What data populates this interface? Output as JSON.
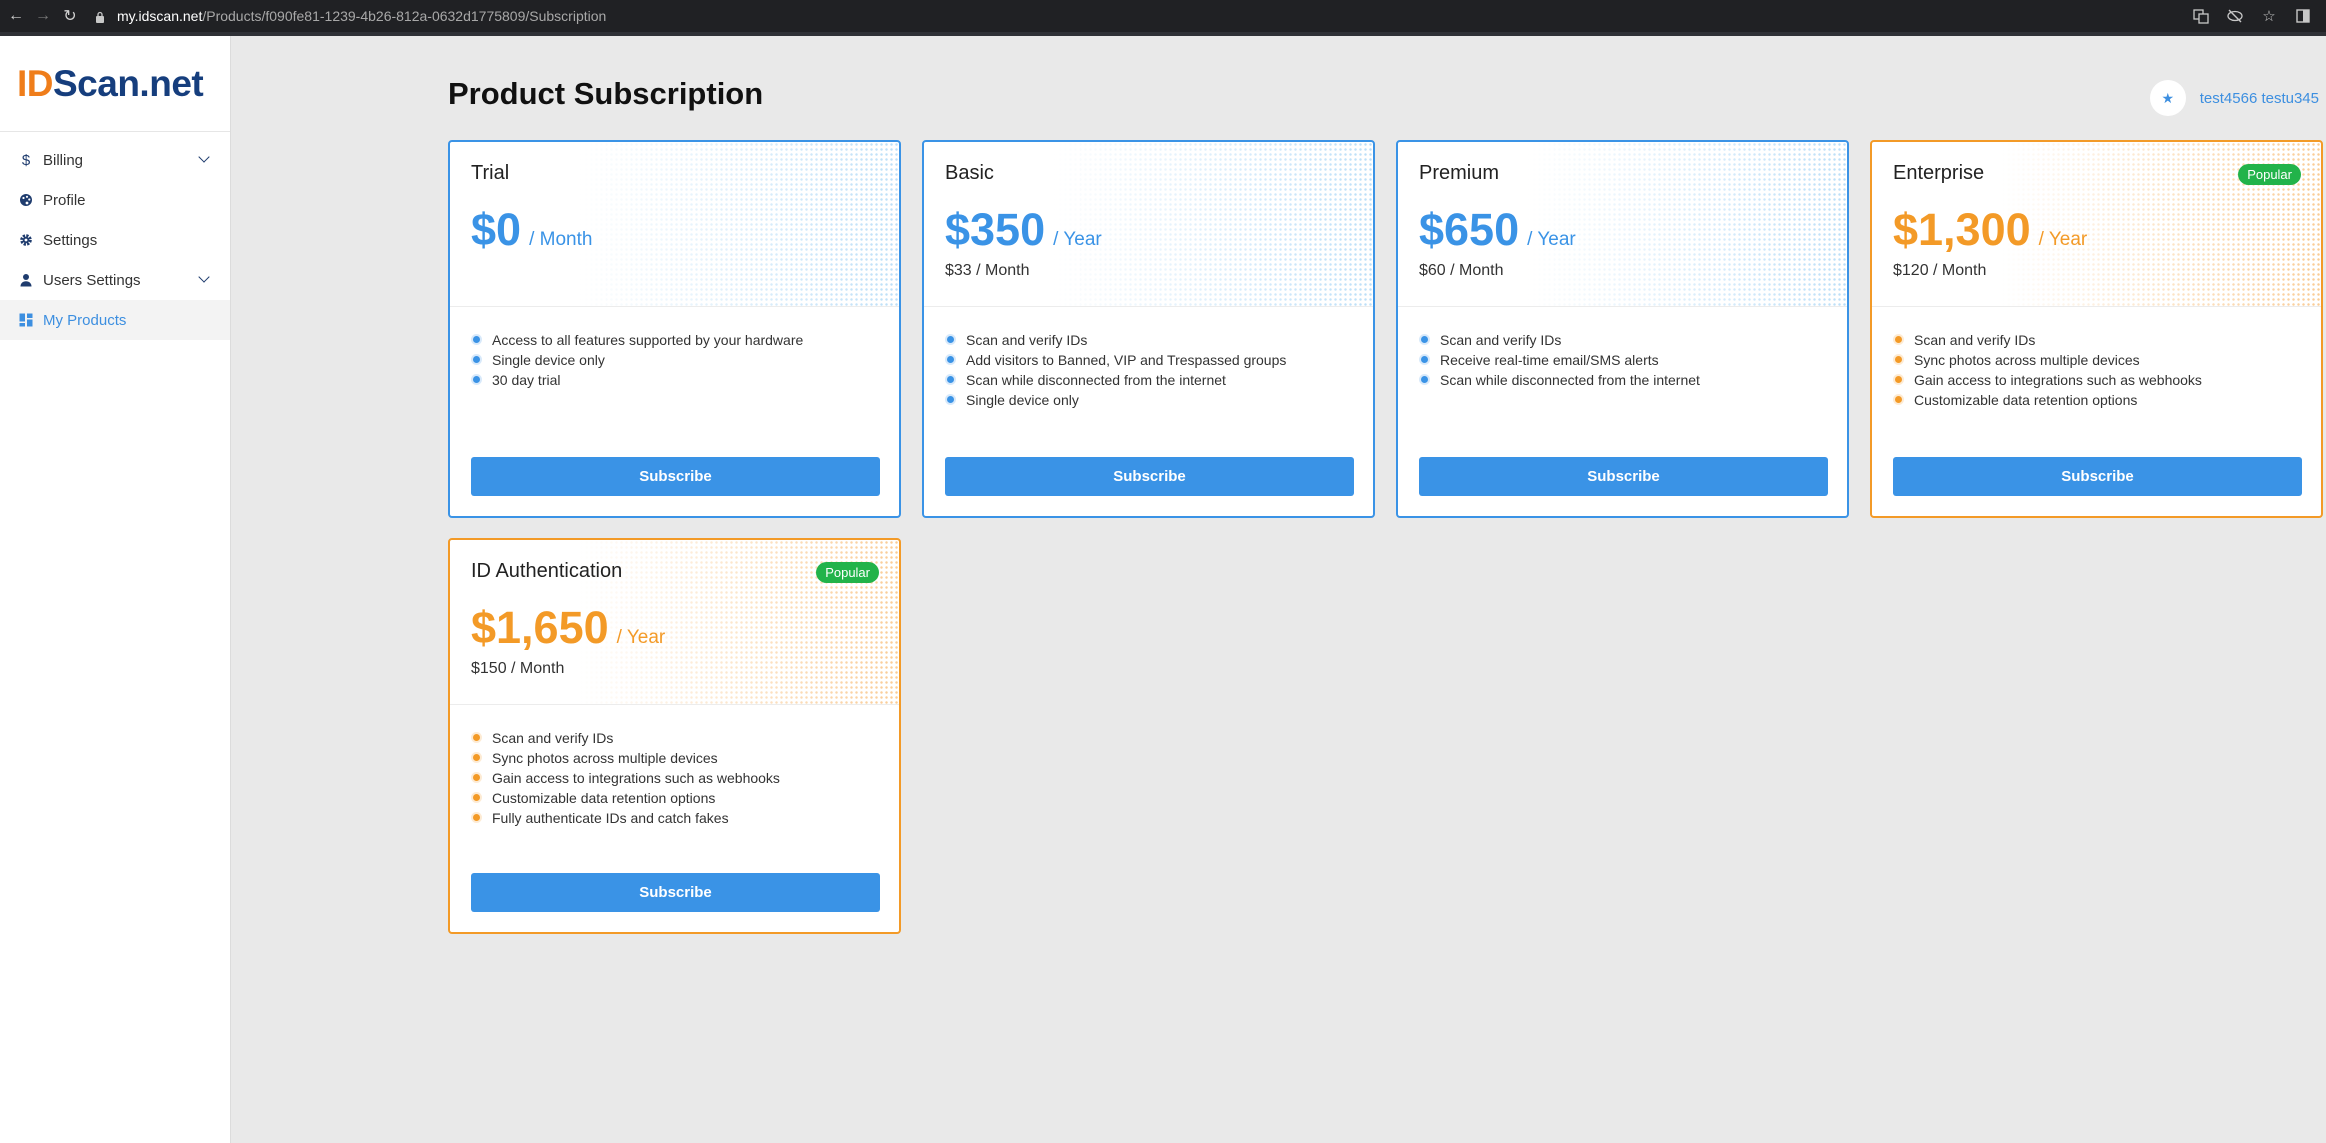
{
  "browser": {
    "url_host": "my.idscan.net",
    "url_path": "/Products/f090fe81-1239-4b26-812a-0632d1775809/Subscription"
  },
  "logo": {
    "id_text": "ID",
    "rest_text": "Scan.net"
  },
  "sidebar": {
    "items": [
      {
        "label": "Billing",
        "icon": "dollar-icon",
        "expandable": true
      },
      {
        "label": "Profile",
        "icon": "palette-icon",
        "expandable": false
      },
      {
        "label": "Settings",
        "icon": "gear-icon",
        "expandable": false
      },
      {
        "label": "Users Settings",
        "icon": "user-icon",
        "expandable": true
      },
      {
        "label": "My Products",
        "icon": "grid-icon",
        "expandable": false,
        "active": true
      }
    ]
  },
  "page": {
    "title": "Product Subscription"
  },
  "user": {
    "name": "test4566 testu345",
    "avatar_icon": "star-icon"
  },
  "colors": {
    "blue": "#3a93e6",
    "orange": "#f39a27",
    "badge_green": "#22b34a"
  },
  "products": [
    {
      "name": "Trial",
      "amount": "$0",
      "period": "/ Month",
      "monthly": "",
      "badge": "",
      "theme": "blue",
      "features": [
        "Access to all features supported by your hardware",
        "Single device only",
        "30 day trial"
      ],
      "button": "Subscribe"
    },
    {
      "name": "Basic",
      "amount": "$350",
      "period": "/ Year",
      "monthly": "$33 / Month",
      "badge": "",
      "theme": "blue",
      "features": [
        "Scan and verify IDs",
        "Add visitors to Banned, VIP and Trespassed groups",
        "Scan while disconnected from the internet",
        "Single device only"
      ],
      "button": "Subscribe"
    },
    {
      "name": "Premium",
      "amount": "$650",
      "period": "/ Year",
      "monthly": "$60 / Month",
      "badge": "",
      "theme": "blue",
      "features": [
        "Scan and verify IDs",
        "Receive real-time email/SMS alerts",
        "Scan while disconnected from the internet"
      ],
      "button": "Subscribe"
    },
    {
      "name": "Enterprise",
      "amount": "$1,300",
      "period": "/ Year",
      "monthly": "$120 / Month",
      "badge": "Popular",
      "theme": "orange",
      "features": [
        "Scan and verify IDs",
        "Sync photos across multiple devices",
        "Gain access to integrations such as webhooks",
        "Customizable data retention options"
      ],
      "button": "Subscribe"
    },
    {
      "name": "ID Authentication",
      "amount": "$1,650",
      "period": "/ Year",
      "monthly": "$150 / Month",
      "badge": "Popular",
      "theme": "orange",
      "features": [
        "Scan and verify IDs",
        "Sync photos across multiple devices",
        "Gain access to integrations such as webhooks",
        "Customizable data retention options",
        "Fully authenticate IDs and catch fakes"
      ],
      "button": "Subscribe"
    }
  ]
}
